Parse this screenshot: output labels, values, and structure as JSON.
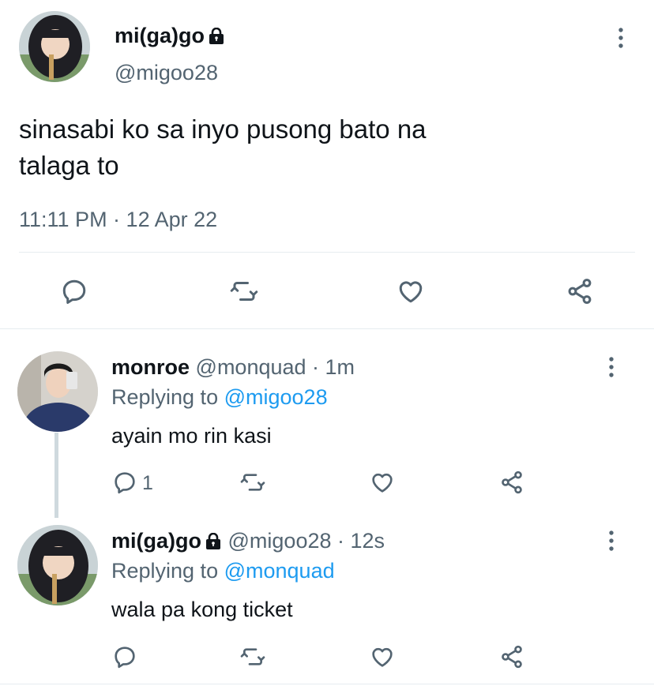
{
  "main_tweet": {
    "display_name": "mi(ga)go",
    "handle": "@migoo28",
    "text_line1": "sinasabi ko sa inyo pusong bato na",
    "text_line2": "talaga to",
    "timestamp": "11:11 PM · 12 Apr 22",
    "icons": [
      "reply-icon",
      "retweet-icon",
      "like-icon",
      "share-icon",
      "more-icon",
      "lock-icon"
    ]
  },
  "replies": [
    {
      "display_name": "monroe",
      "handle": "@monquad",
      "time": "· 1m",
      "replying_prefix": "Replying to",
      "replying_to": "@migoo28",
      "text": "ayain mo rin kasi",
      "reply_count": "1"
    },
    {
      "display_name": "mi(ga)go",
      "handle": "@migoo28",
      "time": "· 12s",
      "replying_prefix": "Replying to",
      "replying_to": "@monquad",
      "text": "wala pa kong ticket",
      "reply_count": ""
    }
  ],
  "colors": {
    "text": "#0f1419",
    "secondary": "#536471",
    "link": "#1d9bf0",
    "divider": "#e6ecf0",
    "thread_line": "#cfd9de"
  }
}
